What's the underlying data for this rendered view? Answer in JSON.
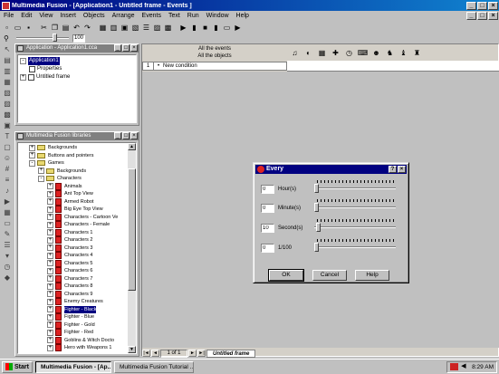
{
  "window": {
    "title": "Multimedia Fusion - [Application1 - Untitled frame - Events ]",
    "controls": [
      "_",
      "□",
      "×"
    ]
  },
  "menu": [
    "File",
    "Edit",
    "View",
    "Insert",
    "Objects",
    "Arrange",
    "Events",
    "Text",
    "Run",
    "Window",
    "Help"
  ],
  "mdi_controls": [
    "_",
    "□",
    "×"
  ],
  "toolbar": {
    "icons": [
      "new-icon",
      "open-icon",
      "save-icon",
      "cut-icon",
      "copy-icon",
      "paste-icon",
      "undo-icon",
      "redo-icon",
      "properties-icon",
      "storyboard-icon",
      "frame-editor-icon",
      "event-editor-icon",
      "event-list-icon",
      "data-elements-icon",
      "grid-icon",
      "play-icon",
      "pause-icon",
      "stop-icon",
      "step-icon",
      "run-frame-icon",
      "run-application-icon"
    ]
  },
  "zoom": {
    "value": "100",
    "percent": 0.75
  },
  "workspace": {
    "title": "Application - Application1.cca",
    "items": [
      {
        "label": "Application1",
        "selected": true
      },
      {
        "label": "Properties"
      },
      {
        "label": "Untitled frame"
      }
    ],
    "expanders": [
      "-",
      "+"
    ]
  },
  "library": {
    "title": "Multimedia Fusion libraries",
    "items": [
      {
        "label": "Backgrounds",
        "kind": "folder",
        "level": 1,
        "exp": "+"
      },
      {
        "label": "Buttons and pointers",
        "kind": "folder",
        "level": 1,
        "exp": "+"
      },
      {
        "label": "Games",
        "kind": "folder",
        "level": 1,
        "exp": "-"
      },
      {
        "label": "Backgrounds",
        "kind": "folder",
        "level": 2,
        "exp": "+"
      },
      {
        "label": "Characters",
        "kind": "folder",
        "level": 2,
        "exp": "-"
      },
      {
        "label": "Animals",
        "kind": "item",
        "level": 3
      },
      {
        "label": "Ant Top View",
        "kind": "item",
        "level": 3
      },
      {
        "label": "Armed Robot",
        "kind": "item",
        "level": 3
      },
      {
        "label": "Big Eye Top View",
        "kind": "item",
        "level": 3
      },
      {
        "label": "Characters - Cartoon Ve",
        "kind": "item",
        "level": 3
      },
      {
        "label": "Characters - Female",
        "kind": "item",
        "level": 3
      },
      {
        "label": "Characters 1",
        "kind": "item",
        "level": 3
      },
      {
        "label": "Characters 2",
        "kind": "item",
        "level": 3
      },
      {
        "label": "Characters 3",
        "kind": "item",
        "level": 3
      },
      {
        "label": "Characters 4",
        "kind": "item",
        "level": 3
      },
      {
        "label": "Characters 5",
        "kind": "item",
        "level": 3
      },
      {
        "label": "Characters 6",
        "kind": "item",
        "level": 3
      },
      {
        "label": "Characters 7",
        "kind": "item",
        "level": 3
      },
      {
        "label": "Characters 8",
        "kind": "item",
        "level": 3
      },
      {
        "label": "Characters 9",
        "kind": "item",
        "level": 3
      },
      {
        "label": "Enemy Creatures",
        "kind": "item",
        "level": 3
      },
      {
        "label": "Fighter - Black",
        "kind": "item",
        "level": 3,
        "selected": true
      },
      {
        "label": "Fighter - Blue",
        "kind": "item",
        "level": 3
      },
      {
        "label": "Fighter - Gold",
        "kind": "item",
        "level": 3
      },
      {
        "label": "Fighter - Red",
        "kind": "item",
        "level": 3
      },
      {
        "label": "Goblins & Witch Docto",
        "kind": "item",
        "level": 3
      },
      {
        "label": "Hero with Weapons 1",
        "kind": "item",
        "level": 3
      }
    ]
  },
  "event_editor": {
    "header": [
      "All the events",
      "All the objects"
    ],
    "row_number": "1",
    "bullet": "•",
    "row_label": "New condition",
    "object_icons": [
      "sound-icon",
      "speaker-icon",
      "storyboard-controls-icon",
      "create-objects-icon",
      "timer-icon",
      "mouse-keyboard-icon",
      "player-icon",
      "active-object-icon",
      "active-object-2-icon",
      "active-object-3-icon"
    ],
    "page_indicator": "1 of 1",
    "frame_tab": "Untitled frame",
    "nav_buttons": [
      "|◄",
      "◄",
      "►",
      "►|"
    ]
  },
  "dialog": {
    "title": "Every",
    "title_buttons": [
      "?",
      "×"
    ],
    "rows": [
      {
        "value": "0",
        "unit": "Hour(s)",
        "level": 0
      },
      {
        "value": "0",
        "unit": "Minute(s)",
        "level": 0
      },
      {
        "value": "10",
        "unit": "Second(s)",
        "level": 0.02
      },
      {
        "value": "0",
        "unit": "1/100",
        "level": 0
      }
    ],
    "buttons": {
      "ok": "OK",
      "cancel": "Cancel",
      "help": "Help"
    }
  },
  "taskbar": {
    "start": "Start",
    "tasks": [
      {
        "label": "Multimedia Fusion - [Ap...",
        "active": true
      },
      {
        "label": "Multimedia Fusion Tutorial ..."
      }
    ],
    "clock": "8:29 AM"
  }
}
